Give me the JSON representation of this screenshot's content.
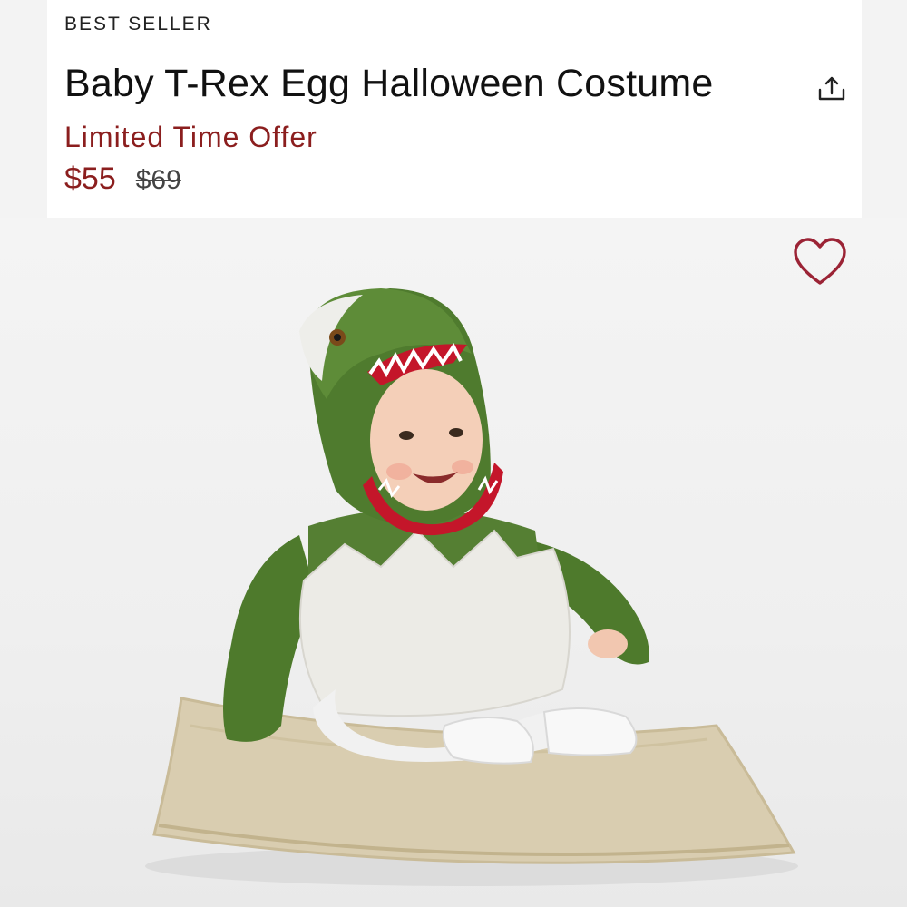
{
  "product": {
    "badge": "BEST SELLER",
    "title": "Baby T-Rex Egg Halloween Costume",
    "offer_label": "Limited Time Offer",
    "price_current": "$55",
    "price_original": "$69"
  },
  "icons": {
    "share": "share-icon",
    "favorite": "heart-outline-icon"
  },
  "colors": {
    "offer_red": "#8b1e1e",
    "heart_red": "#9b2335",
    "header_bg": "#ffffff",
    "photo_bg": "#f3f3f3"
  }
}
